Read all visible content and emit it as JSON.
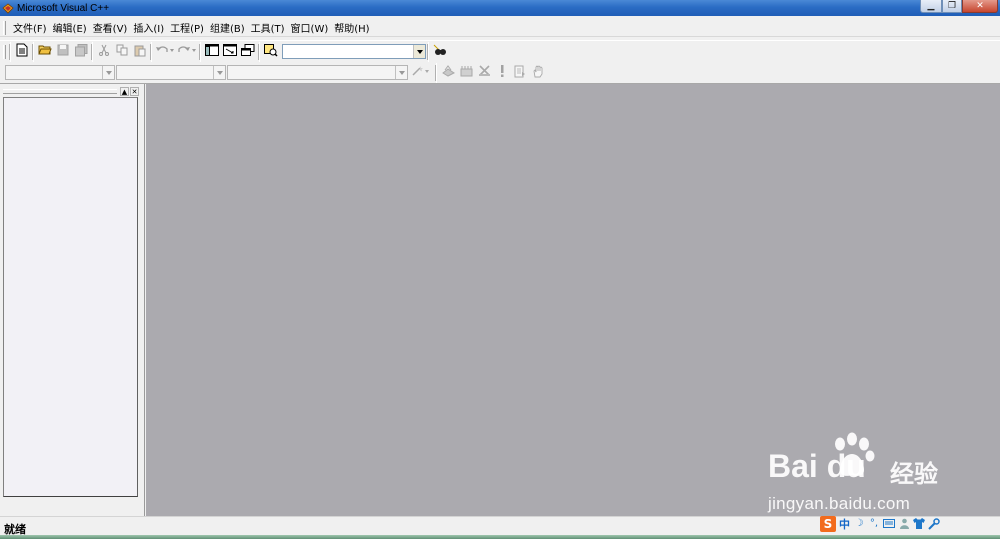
{
  "window": {
    "title": "Microsoft Visual C++"
  },
  "menu": [
    {
      "label": "文件(F)",
      "id": "file"
    },
    {
      "label": "编辑(E)",
      "id": "edit"
    },
    {
      "label": "查看(V)",
      "id": "view"
    },
    {
      "label": "插入(I)",
      "id": "insert"
    },
    {
      "label": "工程(P)",
      "id": "project"
    },
    {
      "label": "组建(B)",
      "id": "build"
    },
    {
      "label": "工具(T)",
      "id": "tools"
    },
    {
      "label": "窗口(W)",
      "id": "window"
    },
    {
      "label": "帮助(H)",
      "id": "help"
    }
  ],
  "toolbar": {
    "find_combo_value": "",
    "class_combo_value": "",
    "filter_combo_value": "",
    "members_combo_value": ""
  },
  "status": {
    "text": "就绪"
  },
  "ime": {
    "logo": "S",
    "mode": "中"
  },
  "watermark": {
    "brand": "Bai du",
    "suffix": "经验",
    "url": "jingyan.baidu.com"
  },
  "colors": {
    "mdi_background": "#abaaaf",
    "titlebar": "#2b6cc4",
    "ime_orange": "#f26b1d"
  }
}
